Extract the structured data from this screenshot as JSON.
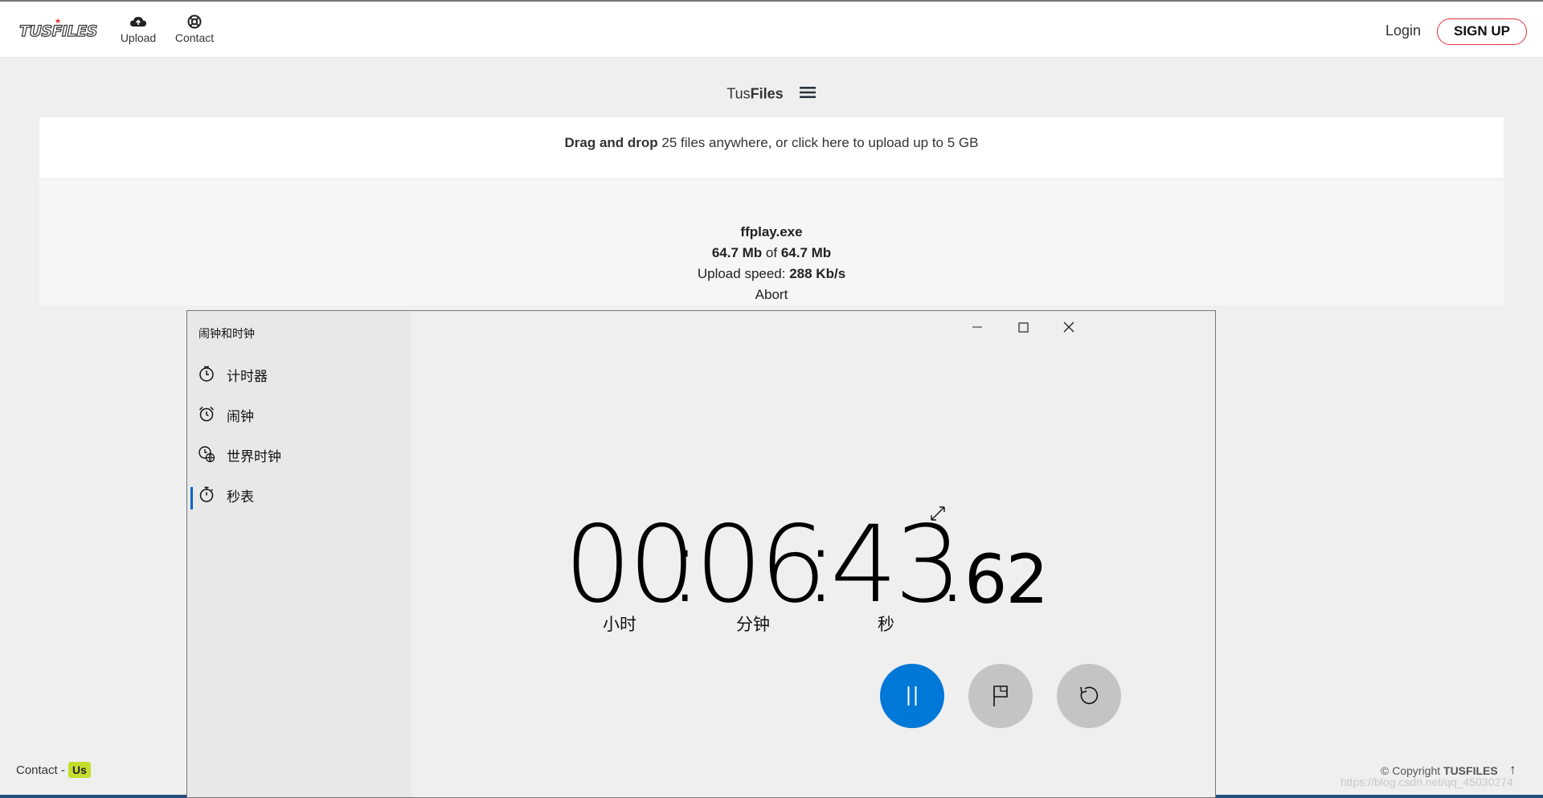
{
  "nav": {
    "logo": "TUSFILES",
    "upload_label": "Upload",
    "contact_label": "Contact",
    "login_label": "Login",
    "signup_label": "SIGN UP"
  },
  "brand": {
    "prefix": "Tus",
    "bold": "Files"
  },
  "dropzone": {
    "bold": "Drag and drop",
    "text": " 25 files anywhere, or click here to upload up to 5 GB"
  },
  "upload": {
    "filename": "ffplay.exe",
    "uploaded": "64.7 Mb",
    "of_word": " of ",
    "total": "64.7 Mb",
    "speed_label": "Upload speed: ",
    "speed_value": "288 Kb/s",
    "abort_label": "Abort"
  },
  "footer": {
    "contact": "Contact - ",
    "us": "Us",
    "copyright": "© Copyright ",
    "brand": "TUSFILES",
    "watermark": "https://blog.csdn.net/qq_45030274"
  },
  "clock_app": {
    "title": "闹钟和时钟",
    "nav_items": [
      {
        "label": "计时器",
        "icon": "timer-icon"
      },
      {
        "label": "闹钟",
        "icon": "alarm-icon"
      },
      {
        "label": "世界时钟",
        "icon": "world-clock-icon"
      },
      {
        "label": "秒表",
        "icon": "stopwatch-icon",
        "active": true
      }
    ],
    "stopwatch": {
      "hours": "00",
      "minutes": "06",
      "seconds": "43",
      "hundredths": "62",
      "sep": ":",
      "dot": ".",
      "unit_hours": "小时",
      "unit_minutes": "分钟",
      "unit_seconds": "秒"
    },
    "colors": {
      "accent": "#0078d7",
      "secondary_button": "#c4c4c4"
    }
  }
}
